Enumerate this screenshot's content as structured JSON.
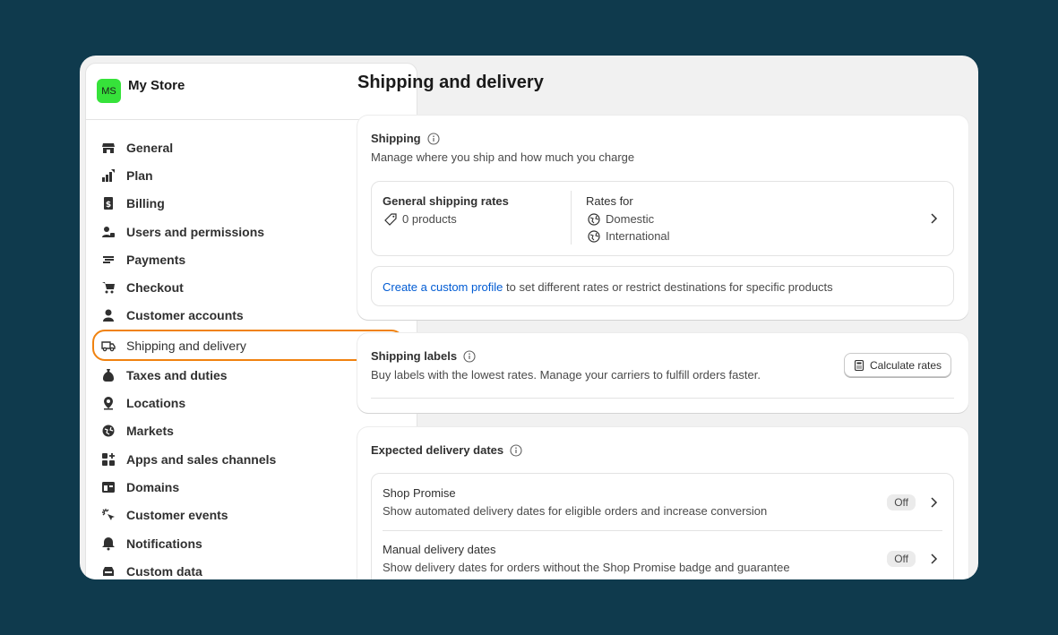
{
  "store": {
    "initials": "MS",
    "name": "My Store"
  },
  "sidebar": {
    "items": [
      {
        "label": "General",
        "icon": "store-icon"
      },
      {
        "label": "Plan",
        "icon": "plan-icon"
      },
      {
        "label": "Billing",
        "icon": "billing-icon"
      },
      {
        "label": "Users and permissions",
        "icon": "users-icon"
      },
      {
        "label": "Payments",
        "icon": "payments-icon"
      },
      {
        "label": "Checkout",
        "icon": "cart-icon"
      },
      {
        "label": "Customer accounts",
        "icon": "person-icon"
      },
      {
        "label": "Shipping and delivery",
        "icon": "truck-icon",
        "active": true
      },
      {
        "label": "Taxes and duties",
        "icon": "tax-icon"
      },
      {
        "label": "Locations",
        "icon": "location-icon"
      },
      {
        "label": "Markets",
        "icon": "globe-icon"
      },
      {
        "label": "Apps and sales channels",
        "icon": "apps-icon"
      },
      {
        "label": "Domains",
        "icon": "domain-icon"
      },
      {
        "label": "Customer events",
        "icon": "cursor-click-icon"
      },
      {
        "label": "Notifications",
        "icon": "bell-icon"
      },
      {
        "label": "Custom data",
        "icon": "database-icon"
      }
    ],
    "highlight_color": "#f0820f"
  },
  "main": {
    "title": "Shipping and delivery",
    "shipping": {
      "title": "Shipping",
      "subtitle": "Manage where you ship and how much you charge",
      "general_rates_title": "General shipping rates",
      "products": "0 products",
      "rates_for_label": "Rates for",
      "destinations": [
        "Domestic",
        "International"
      ],
      "custom_profile_link": "Create a custom profile",
      "custom_profile_text": " to set different rates or restrict destinations for specific products"
    },
    "labels": {
      "title": "Shipping labels",
      "subtitle": "Buy labels with the lowest rates. Manage your carriers to fulfill orders faster.",
      "button": "Calculate rates"
    },
    "delivery": {
      "title": "Expected delivery dates",
      "rows": [
        {
          "title": "Shop Promise",
          "subtitle": "Show automated delivery dates for eligible orders and increase conversion",
          "status": "Off"
        },
        {
          "title": "Manual delivery dates",
          "subtitle": "Show delivery dates for orders without the Shop Promise badge and guarantee",
          "status": "Off"
        }
      ]
    }
  },
  "colors": {
    "background": "#0f3a4d",
    "link": "#005bd3",
    "avatar": "#36e23a"
  }
}
